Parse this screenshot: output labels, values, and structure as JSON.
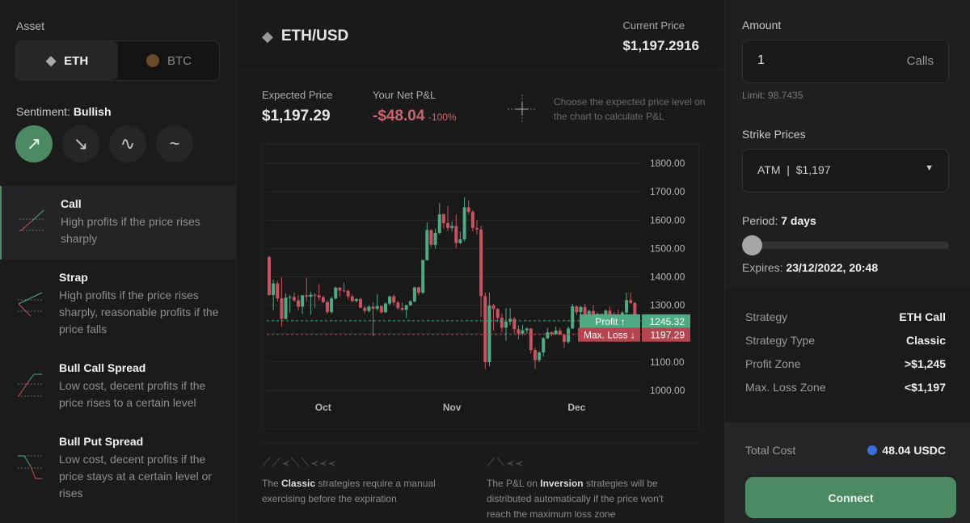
{
  "left": {
    "asset_label": "Asset",
    "assets": [
      {
        "label": "ETH",
        "icon": "ethereum-icon",
        "selected": true
      },
      {
        "label": "BTC",
        "icon": "bitcoin-icon",
        "selected": false
      }
    ],
    "sentiment_label": "Sentiment:",
    "sentiment_value": "Bullish",
    "sentiments": [
      {
        "icon": "arrow-up-right-icon",
        "glyph": "↗",
        "selected": true
      },
      {
        "icon": "arrow-down-right-icon",
        "glyph": "↘",
        "selected": false
      },
      {
        "icon": "wave-icon",
        "glyph": "∿",
        "selected": false
      },
      {
        "icon": "tilde-icon",
        "glyph": "~",
        "selected": false
      }
    ],
    "strategies": [
      {
        "title": "Call",
        "desc": "High profits if the price rises sharply",
        "selected": true
      },
      {
        "title": "Strap",
        "desc": "High profits if the price rises sharply, reasonable profits if the price falls",
        "selected": false
      },
      {
        "title": "Bull Call Spread",
        "desc": "Low cost, decent profits if the price rises to a certain level",
        "selected": false
      },
      {
        "title": "Bull Put Spread",
        "desc": "Low cost, decent profits if the price stays at a certain level or rises",
        "selected": false
      }
    ]
  },
  "header": {
    "pair": "ETH/USD",
    "current_price_label": "Current Price",
    "current_price": "$1,197.2916"
  },
  "stats": {
    "expected_label": "Expected Price",
    "expected_value": "$1,197.29",
    "pnl_label": "Your Net P&L",
    "pnl_value": "-$48.04",
    "pnl_pct": "-100%",
    "hint": "Choose the expected price level on the chart to calculate P&L"
  },
  "colors": {
    "up": "#4fa983",
    "down": "#c8535f",
    "accent": "#4b8a62"
  },
  "chart_data": {
    "type": "candlestick",
    "x_tick_labels": [
      "Oct",
      "Nov",
      "Dec"
    ],
    "x_ticks": [
      "2022-10-01",
      "2022-11-01",
      "2022-12-01"
    ],
    "y_tick_labels": [
      "1800.00",
      "1700.00",
      "1600.00",
      "1500.00",
      "1400.00",
      "1300.00",
      "1200.00",
      "1100.00",
      "1000.00"
    ],
    "ylim": [
      1000,
      1800
    ],
    "grid": true,
    "levels": [
      {
        "name": "Profit ↑",
        "value": "1245.32",
        "color": "#4fa983"
      },
      {
        "name": "Max. Loss ↓",
        "value": "1197.29",
        "color": "#b5464f"
      }
    ],
    "candles": [
      [
        "2022-09-18",
        1470,
        1474,
        1335,
        1336
      ],
      [
        "2022-09-19",
        1336,
        1390,
        1283,
        1377
      ],
      [
        "2022-09-20",
        1377,
        1386,
        1313,
        1324
      ],
      [
        "2022-09-21",
        1324,
        1398,
        1224,
        1252
      ],
      [
        "2022-09-22",
        1252,
        1342,
        1250,
        1327
      ],
      [
        "2022-09-23",
        1327,
        1336,
        1273,
        1329
      ],
      [
        "2022-09-24",
        1329,
        1345,
        1312,
        1317
      ],
      [
        "2022-09-25",
        1317,
        1336,
        1282,
        1295
      ],
      [
        "2022-09-26",
        1295,
        1336,
        1269,
        1335
      ],
      [
        "2022-09-27",
        1335,
        1397,
        1313,
        1330
      ],
      [
        "2022-09-28",
        1330,
        1348,
        1267,
        1337
      ],
      [
        "2022-09-29",
        1337,
        1342,
        1290,
        1335
      ],
      [
        "2022-09-30",
        1335,
        1375,
        1317,
        1328
      ],
      [
        "2022-10-01",
        1328,
        1334,
        1307,
        1311
      ],
      [
        "2022-10-02",
        1311,
        1318,
        1270,
        1276
      ],
      [
        "2022-10-03",
        1276,
        1330,
        1270,
        1324
      ],
      [
        "2022-10-04",
        1324,
        1366,
        1320,
        1362
      ],
      [
        "2022-10-05",
        1362,
        1364,
        1330,
        1352
      ],
      [
        "2022-10-06",
        1352,
        1380,
        1345,
        1351
      ],
      [
        "2022-10-07",
        1351,
        1355,
        1320,
        1331
      ],
      [
        "2022-10-08",
        1331,
        1338,
        1310,
        1315
      ],
      [
        "2022-10-09",
        1315,
        1325,
        1310,
        1322
      ],
      [
        "2022-10-10",
        1322,
        1327,
        1290,
        1291
      ],
      [
        "2022-10-11",
        1291,
        1298,
        1270,
        1280
      ],
      [
        "2022-10-12",
        1280,
        1300,
        1275,
        1295
      ],
      [
        "2022-10-13",
        1295,
        1310,
        1190,
        1288
      ],
      [
        "2022-10-14",
        1288,
        1340,
        1280,
        1297
      ],
      [
        "2022-10-15",
        1297,
        1300,
        1270,
        1275
      ],
      [
        "2022-10-16",
        1275,
        1310,
        1274,
        1306
      ],
      [
        "2022-10-17",
        1306,
        1334,
        1300,
        1331
      ],
      [
        "2022-10-18",
        1331,
        1338,
        1300,
        1310
      ],
      [
        "2022-10-19",
        1310,
        1315,
        1285,
        1290
      ],
      [
        "2022-10-20",
        1290,
        1310,
        1280,
        1284
      ],
      [
        "2022-10-21",
        1284,
        1302,
        1255,
        1300
      ],
      [
        "2022-10-22",
        1300,
        1318,
        1298,
        1314
      ],
      [
        "2022-10-23",
        1314,
        1365,
        1310,
        1363
      ],
      [
        "2022-10-24",
        1363,
        1366,
        1335,
        1344
      ],
      [
        "2022-10-25",
        1344,
        1460,
        1340,
        1459
      ],
      [
        "2022-10-26",
        1459,
        1592,
        1457,
        1565
      ],
      [
        "2022-10-27",
        1565,
        1568,
        1505,
        1513
      ],
      [
        "2022-10-28",
        1513,
        1570,
        1500,
        1555
      ],
      [
        "2022-10-29",
        1555,
        1660,
        1550,
        1620
      ],
      [
        "2022-10-30",
        1620,
        1625,
        1570,
        1589
      ],
      [
        "2022-10-31",
        1589,
        1650,
        1560,
        1572
      ],
      [
        "2022-11-01",
        1572,
        1595,
        1560,
        1579
      ],
      [
        "2022-11-02",
        1579,
        1620,
        1500,
        1519
      ],
      [
        "2022-11-03",
        1519,
        1560,
        1515,
        1532
      ],
      [
        "2022-11-04",
        1532,
        1680,
        1525,
        1645
      ],
      [
        "2022-11-05",
        1645,
        1670,
        1620,
        1629
      ],
      [
        "2022-11-06",
        1629,
        1635,
        1560,
        1572
      ],
      [
        "2022-11-07",
        1572,
        1600,
        1550,
        1567
      ],
      [
        "2022-11-08",
        1567,
        1580,
        1260,
        1332
      ],
      [
        "2022-11-09",
        1332,
        1345,
        1075,
        1100
      ],
      [
        "2022-11-10",
        1100,
        1345,
        1085,
        1299
      ],
      [
        "2022-11-11",
        1299,
        1305,
        1210,
        1287
      ],
      [
        "2022-11-12",
        1287,
        1290,
        1240,
        1256
      ],
      [
        "2022-11-13",
        1256,
        1270,
        1205,
        1221
      ],
      [
        "2022-11-14",
        1221,
        1290,
        1175,
        1242
      ],
      [
        "2022-11-15",
        1242,
        1290,
        1230,
        1252
      ],
      [
        "2022-11-16",
        1252,
        1260,
        1200,
        1216
      ],
      [
        "2022-11-17",
        1216,
        1230,
        1180,
        1200
      ],
      [
        "2022-11-18",
        1200,
        1230,
        1195,
        1212
      ],
      [
        "2022-11-19",
        1212,
        1222,
        1200,
        1218
      ],
      [
        "2022-11-20",
        1218,
        1220,
        1130,
        1142
      ],
      [
        "2022-11-21",
        1142,
        1150,
        1075,
        1107
      ],
      [
        "2022-11-22",
        1107,
        1138,
        1100,
        1134
      ],
      [
        "2022-11-23",
        1134,
        1188,
        1120,
        1184
      ],
      [
        "2022-11-24",
        1184,
        1220,
        1180,
        1205
      ],
      [
        "2022-11-25",
        1205,
        1207,
        1190,
        1198
      ],
      [
        "2022-11-26",
        1198,
        1225,
        1196,
        1211
      ],
      [
        "2022-11-27",
        1211,
        1220,
        1195,
        1196
      ],
      [
        "2022-11-28",
        1196,
        1198,
        1150,
        1171
      ],
      [
        "2022-11-29",
        1171,
        1225,
        1165,
        1218
      ],
      [
        "2022-11-30",
        1218,
        1305,
        1216,
        1296
      ],
      [
        "2022-12-01",
        1296,
        1300,
        1265,
        1276
      ],
      [
        "2022-12-02",
        1276,
        1298,
        1260,
        1294
      ],
      [
        "2022-12-03",
        1294,
        1305,
        1238,
        1241
      ],
      [
        "2022-12-04",
        1241,
        1285,
        1240,
        1280
      ],
      [
        "2022-12-05",
        1280,
        1300,
        1255,
        1259
      ],
      [
        "2022-12-06",
        1259,
        1275,
        1248,
        1270
      ],
      [
        "2022-12-07",
        1270,
        1272,
        1220,
        1232
      ],
      [
        "2022-12-08",
        1232,
        1285,
        1230,
        1281
      ],
      [
        "2022-12-09",
        1281,
        1295,
        1260,
        1264
      ],
      [
        "2022-12-10",
        1264,
        1275,
        1260,
        1265
      ],
      [
        "2022-12-11",
        1265,
        1285,
        1260,
        1263
      ],
      [
        "2022-12-12",
        1263,
        1280,
        1240,
        1274
      ],
      [
        "2022-12-13",
        1274,
        1345,
        1265,
        1318
      ],
      [
        "2022-12-14",
        1318,
        1345,
        1305,
        1308
      ],
      [
        "2022-12-15",
        1308,
        1312,
        1260,
        1266
      ]
    ]
  },
  "notes": {
    "classic_pre": "The ",
    "classic_bold": "Classic",
    "classic_post": " strategies require a manual exercising before the expiration",
    "inversion_pre": "The P&L on ",
    "inversion_bold": "Inversion",
    "inversion_post": " strategies will be distributed automatically if the price won't reach the maximum loss zone"
  },
  "right": {
    "amount_label": "Amount",
    "amount_value": "1",
    "amount_unit": "Calls",
    "limit": "Limit: 98.7435",
    "strike_label": "Strike Prices",
    "strike_value": "ATM  |  $1,197",
    "period_label": "Period:",
    "period_value": "7 days",
    "period_fraction": 0,
    "expires_label": "Expires:",
    "expires_value": "23/12/2022, 20:48",
    "summary": [
      {
        "k": "Strategy",
        "v": "ETH Call"
      },
      {
        "k": "Strategy Type",
        "v": "Classic"
      },
      {
        "k": "Profit Zone",
        "v": ">$1,245"
      },
      {
        "k": "Max. Loss Zone",
        "v": "<$1,197"
      }
    ],
    "total_label": "Total Cost",
    "total_value": "48.04 USDC",
    "connect": "Connect"
  }
}
